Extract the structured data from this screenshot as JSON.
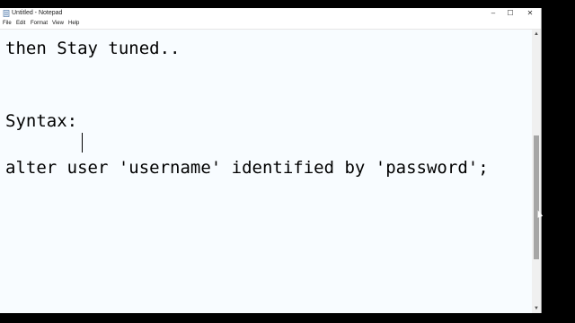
{
  "window": {
    "title": "Untitled - Notepad"
  },
  "controls": {
    "minimize": "–",
    "maximize": "☐",
    "close": "✕"
  },
  "menu": [
    "File",
    "Edit",
    "Format",
    "View",
    "Help"
  ],
  "editor": {
    "lines": [
      "then Stay tuned..",
      "Syntax:",
      "alter user 'username' identified by 'password';"
    ]
  },
  "scrollbar": {
    "up_arrow": "▲",
    "down_arrow": "▼"
  }
}
